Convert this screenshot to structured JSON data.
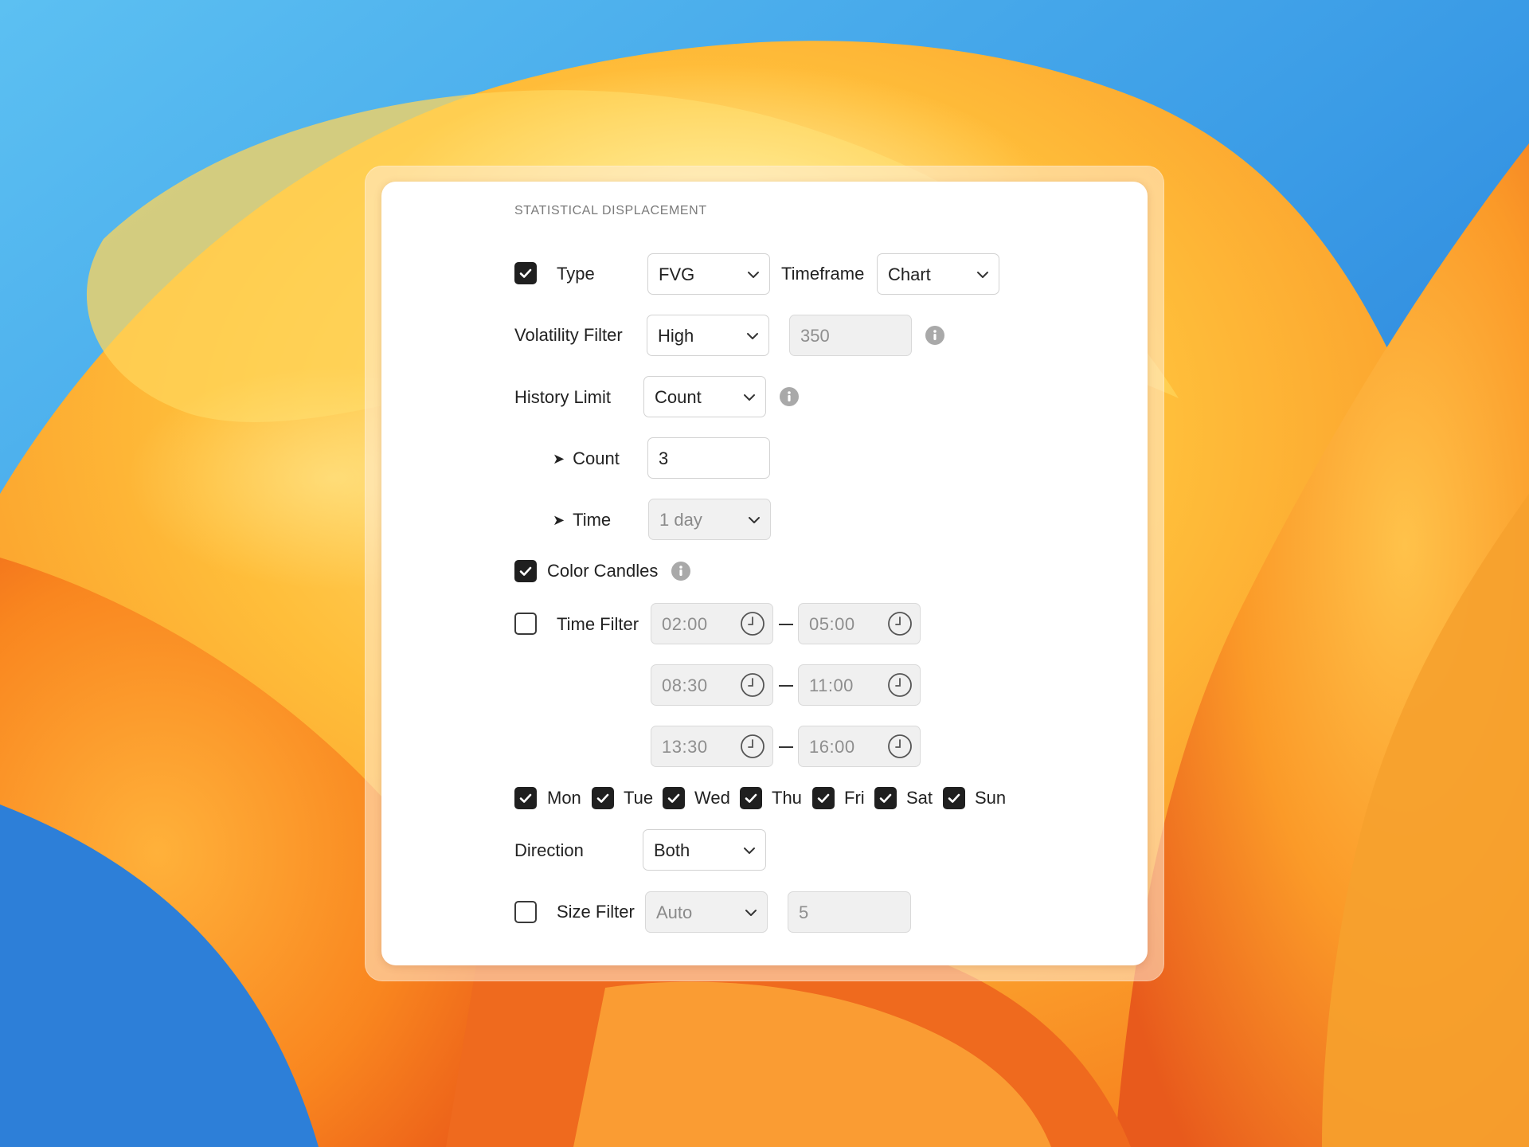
{
  "panel": {
    "title": "STATISTICAL DISPLACEMENT",
    "type_row": {
      "checked": true,
      "label": "Type",
      "select": "FVG",
      "timeframe_label": "Timeframe",
      "timeframe_select": "Chart"
    },
    "volatility_row": {
      "label": "Volatility Filter",
      "select": "High",
      "value": "350"
    },
    "history_row": {
      "label": "History Limit",
      "select": "Count"
    },
    "count_row": {
      "arrow": "➤",
      "label": "Count",
      "value": "3"
    },
    "time_row": {
      "arrow": "➤",
      "label": "Time",
      "select": "1 day"
    },
    "color_candles": {
      "checked": true,
      "label": "Color Candles"
    },
    "time_filter": {
      "checked": false,
      "label": "Time Filter",
      "ranges": [
        {
          "start": "02:00",
          "end": "05:00"
        },
        {
          "start": "08:30",
          "end": "11:00"
        },
        {
          "start": "13:30",
          "end": "16:00"
        }
      ]
    },
    "days": [
      {
        "label": "Mon",
        "checked": true
      },
      {
        "label": "Tue",
        "checked": true
      },
      {
        "label": "Wed",
        "checked": true
      },
      {
        "label": "Thu",
        "checked": true
      },
      {
        "label": "Fri",
        "checked": true
      },
      {
        "label": "Sat",
        "checked": true
      },
      {
        "label": "Sun",
        "checked": true
      }
    ],
    "direction_row": {
      "label": "Direction",
      "select": "Both"
    },
    "size_filter": {
      "checked": false,
      "label": "Size Filter",
      "select": "Auto",
      "value": "5"
    }
  },
  "colors": {
    "checkbox_on": "#1f1f1f",
    "panel_bg": "#ffffff",
    "info_icon": "#a9a9a9"
  }
}
